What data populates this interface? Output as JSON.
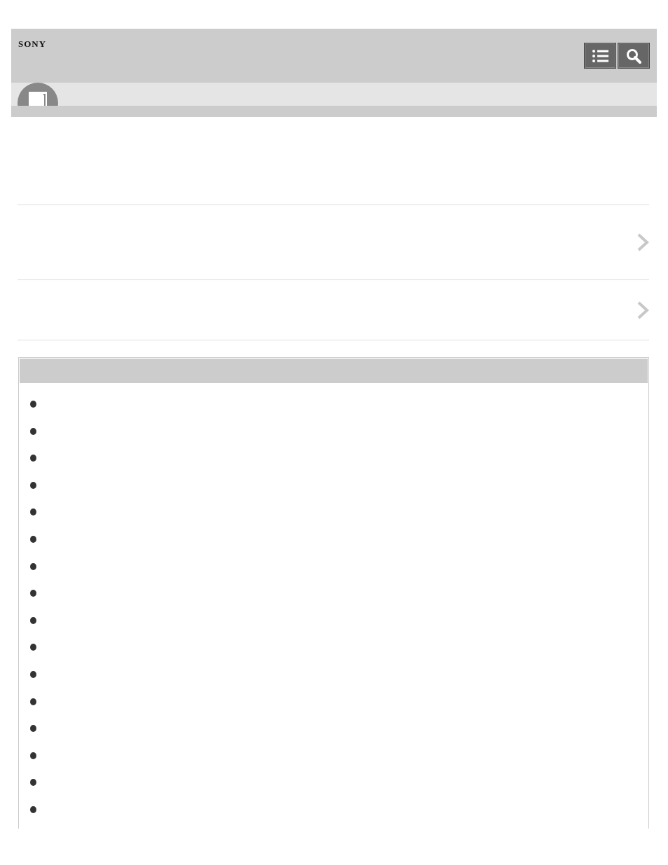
{
  "header": {
    "logo": "SONY",
    "buttons": [
      {
        "kind": "menu"
      },
      {
        "kind": "search"
      }
    ]
  },
  "category_band": {
    "icon": {
      "kind": "book"
    }
  },
  "links": [
    {
      "kind": "chevron"
    },
    {
      "kind": "chevron"
    }
  ],
  "panel": {
    "items": [
      {
        "kind": "bullet"
      },
      {
        "kind": "bullet"
      },
      {
        "kind": "bullet"
      },
      {
        "kind": "bullet"
      },
      {
        "kind": "bullet"
      },
      {
        "kind": "bullet"
      },
      {
        "kind": "bullet"
      },
      {
        "kind": "bullet"
      },
      {
        "kind": "bullet"
      },
      {
        "kind": "bullet"
      },
      {
        "kind": "bullet"
      },
      {
        "kind": "bullet"
      },
      {
        "kind": "bullet"
      },
      {
        "kind": "bullet"
      },
      {
        "kind": "bullet"
      },
      {
        "kind": "bullet"
      }
    ]
  }
}
